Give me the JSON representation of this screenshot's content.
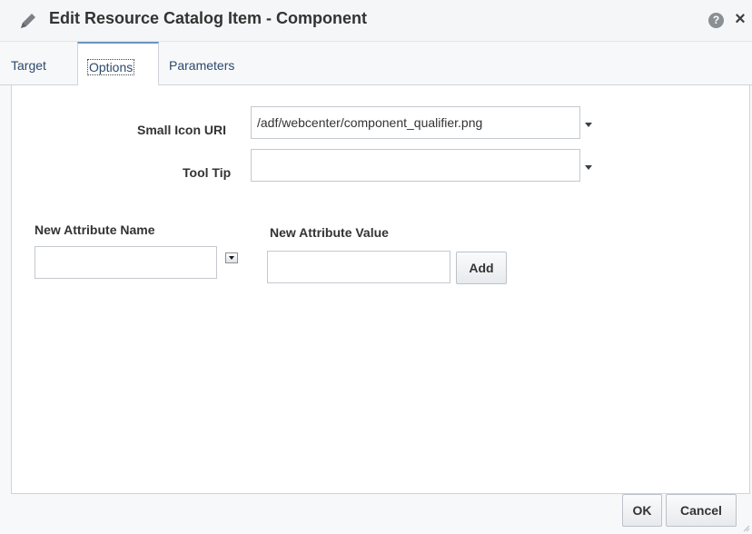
{
  "dialog": {
    "title": "Edit Resource Catalog Item - Component",
    "help_glyph": "?",
    "close_glyph": "×",
    "icons": {
      "title": "pencil-icon",
      "help": "help-icon",
      "close": "close-icon"
    }
  },
  "tabs": [
    {
      "label": "Target",
      "selected": false
    },
    {
      "label": "Options",
      "selected": true
    },
    {
      "label": "Parameters",
      "selected": false
    }
  ],
  "form": {
    "small_icon_uri": {
      "label": "Small Icon URI",
      "value": "/adf/webcenter/component_qualifier.png"
    },
    "tool_tip": {
      "label": "Tool Tip",
      "value": ""
    },
    "new_attribute_name": {
      "label": "New Attribute Name",
      "value": ""
    },
    "new_attribute_value": {
      "label": "New Attribute Value",
      "value": ""
    },
    "add_label": "Add"
  },
  "footer": {
    "ok_label": "OK",
    "cancel_label": "Cancel"
  },
  "colors": {
    "tab_accent": "#6a95c7",
    "background": "#f7f8f9",
    "panel": "#ffffff"
  }
}
